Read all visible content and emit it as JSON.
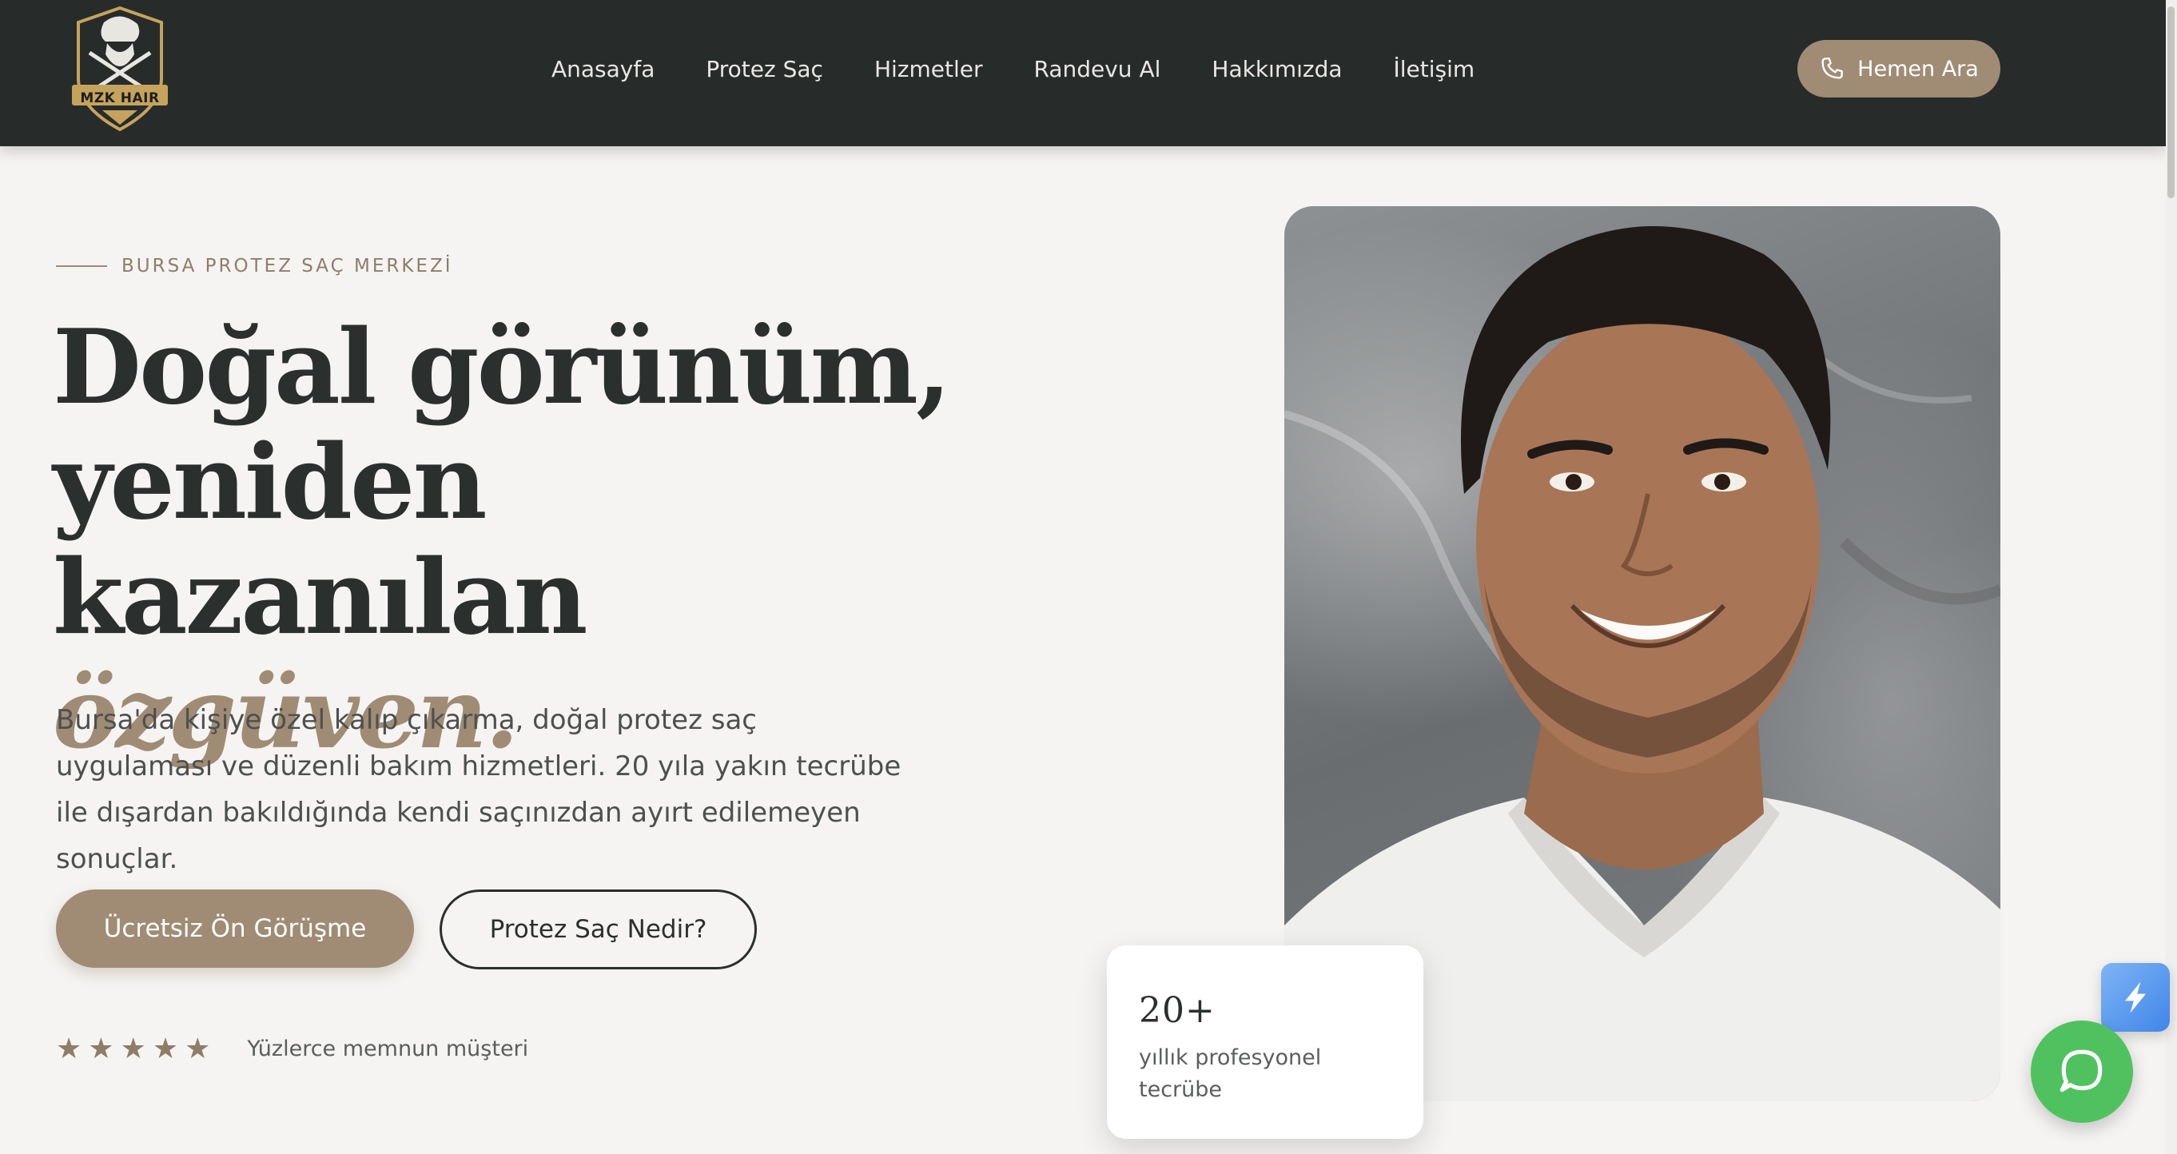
{
  "brand": {
    "logo_text": "MZK HAIR"
  },
  "nav": {
    "items": [
      {
        "label": "Anasayfa"
      },
      {
        "label": "Protez Saç"
      },
      {
        "label": "Hizmetler"
      },
      {
        "label": "Randevu Al"
      },
      {
        "label": "Hakkımızda"
      },
      {
        "label": "İletişim"
      }
    ],
    "call_button": "Hemen Ara"
  },
  "hero": {
    "eyebrow": "BURSA PROTEZ SAÇ MERKEZİ",
    "headline_line1": "Doğal görünüm,",
    "headline_line2": "yeniden kazanılan",
    "headline_accent": "özgüven.",
    "lead": "Bursa'da kişiye özel kalıp çıkarma, doğal protez saç uygulaması ve düzenli bakım hizmetleri. 20 yıla yakın tecrübe ile dışardan bakıldığında kendi saçınızdan ayırt edilemeyen sonuçlar.",
    "primary_button": "Ücretsiz Ön Görüşme",
    "secondary_button": "Protez Saç Nedir?",
    "rating": {
      "stars": 5,
      "text": "Yüzlerce memnun müşteri"
    }
  },
  "stat_card": {
    "number": "20+",
    "description": "yıllık profesyonel tecrübe"
  },
  "colors": {
    "header_bg": "#272c2b",
    "accent": "#a08b74",
    "page_bg": "#f5f4f2",
    "text_dark": "#2b2f2e",
    "whatsapp": "#4fc25f"
  },
  "icons": {
    "phone": "phone-icon",
    "star": "star-icon",
    "whatsapp": "whatsapp-icon",
    "widget": "lightning-widget-icon"
  }
}
